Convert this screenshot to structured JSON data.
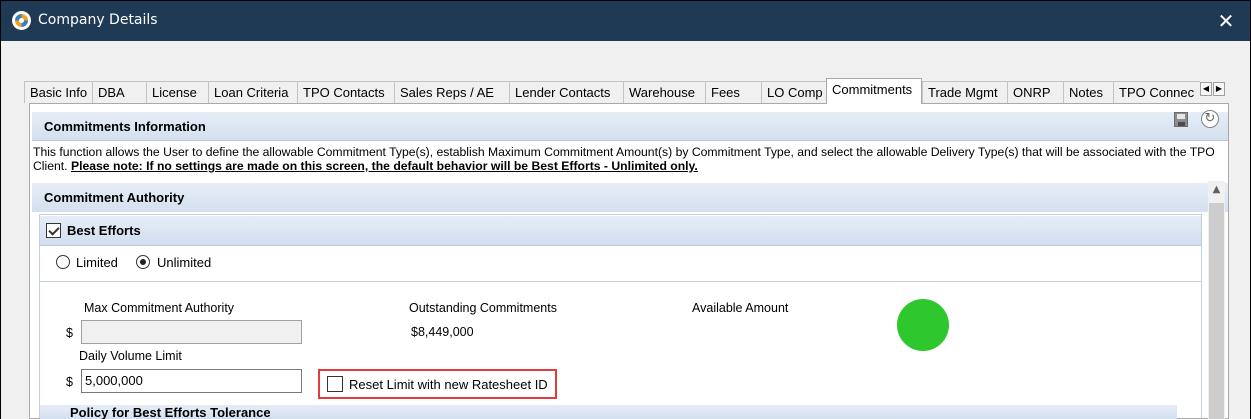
{
  "window": {
    "title": "Company Details",
    "close_glyph": "✕",
    "app_icon": "app-logo-icon"
  },
  "tabs": [
    {
      "label": "Basic Info",
      "active": false
    },
    {
      "label": "DBA",
      "active": false
    },
    {
      "label": "License",
      "active": false
    },
    {
      "label": "Loan Criteria",
      "active": false
    },
    {
      "label": "TPO Contacts",
      "active": false
    },
    {
      "label": "Sales Reps / AE",
      "active": false
    },
    {
      "label": "Lender Contacts",
      "active": false
    },
    {
      "label": "Warehouse",
      "active": false
    },
    {
      "label": "Fees",
      "active": false
    },
    {
      "label": "LO Comp",
      "active": false
    },
    {
      "label": "Commitments",
      "active": true
    },
    {
      "label": "Trade Mgmt",
      "active": false
    },
    {
      "label": "ONRP",
      "active": false
    },
    {
      "label": "Notes",
      "active": false
    },
    {
      "label": "TPO Connec",
      "active": false
    }
  ],
  "tab_scroll": {
    "left": "◀",
    "right": "▶"
  },
  "commitments_info": {
    "header": "Commitments Information",
    "description": "This function allows the User to define the allowable Commitment Type(s), establish Maximum Commitment Amount(s) by Commitment Type, and select the allowable Delivery Type(s) that will be associated with the TPO Client.",
    "note": "Please note: If no settings are made on this screen, the default behavior will be Best Efforts - Unlimited only.",
    "refresh_glyph": "↻"
  },
  "commitment_authority": {
    "header": "Commitment Authority"
  },
  "best_efforts": {
    "label": "Best Efforts",
    "checked": true,
    "radio_limited": "Limited",
    "radio_unlimited": "Unlimited",
    "selected": "Unlimited",
    "max_commitment_label": "Max Commitment Authority",
    "max_commitment_value": "",
    "currency": "$",
    "outstanding_label": "Outstanding Commitments",
    "outstanding_value": "$8,449,000",
    "available_label": "Available Amount",
    "status_color": "#2ec72e",
    "daily_volume_label": "Daily Volume Limit",
    "daily_volume_value": "5,000,000",
    "reset_label": "Reset Limit with new Ratesheet ID",
    "reset_checked": false,
    "policy_header": "Policy for Best Efforts Tolerance"
  },
  "scrollbar": {
    "up_glyph": "▲"
  }
}
